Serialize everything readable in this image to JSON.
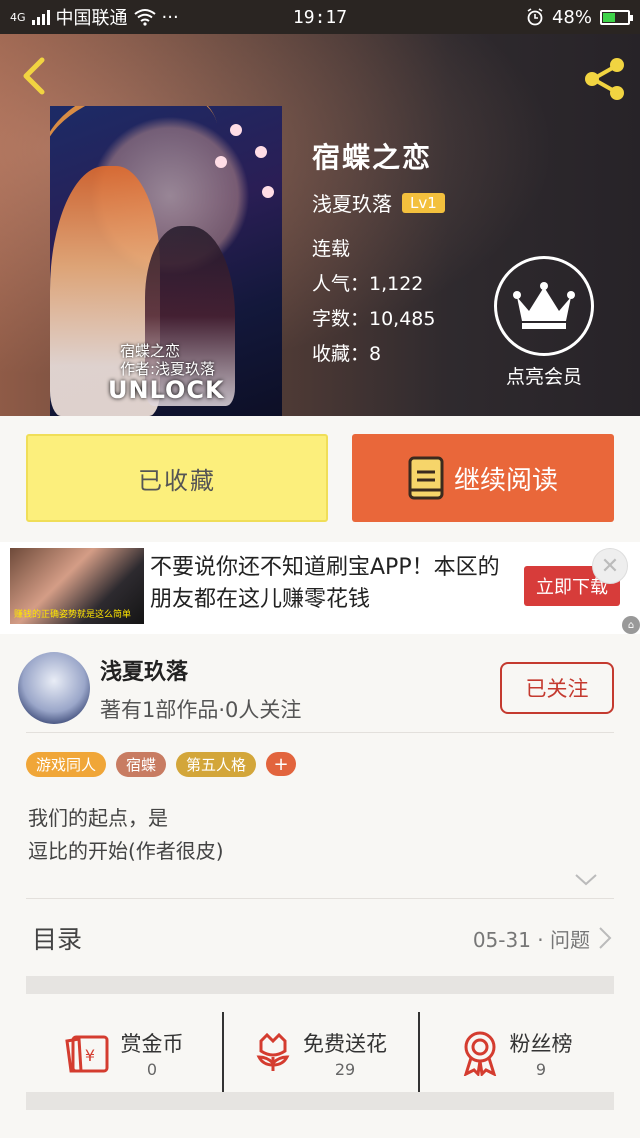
{
  "status_bar": {
    "network": "4G",
    "carrier": "中国联通",
    "more": "···",
    "time": "19:17",
    "battery": "48%",
    "battery_level": 0.48
  },
  "book": {
    "title": "宿蝶之恋",
    "author": "浅夏玖落",
    "level": "Lv1",
    "status": "连载",
    "popularity": "人气：1,122",
    "words": "字数：10,485",
    "favorites": "收藏：8",
    "cover_caption_line1": "宿蝶之恋",
    "cover_caption_line2": "作者:浅夏玖落",
    "cover_logo": "UNLOCK"
  },
  "vip": {
    "label": "点亮会员"
  },
  "actions": {
    "collected_label": "已收藏",
    "read_label": "继续阅读"
  },
  "ad": {
    "text": "不要说你还不知道刷宝APP！本区的朋友都在这儿赚零花钱",
    "cta": "立即下载",
    "thumb_caption": "赚钱的正确姿势就是这么简单"
  },
  "author": {
    "name": "浅夏玖落",
    "stats": "著有1部作品·0人关注",
    "follow_label": "已关注"
  },
  "tags": [
    {
      "label": "游戏同人",
      "color": "#f0a638"
    },
    {
      "label": "宿蝶",
      "color": "#c87c62"
    },
    {
      "label": "第五人格",
      "color": "#d3a63a"
    }
  ],
  "tag_more": "+",
  "intro": "我们的起点，是\n逗比的开始(作者很皮)",
  "catalog": {
    "title": "目录",
    "latest": "05-31 · 问题"
  },
  "stats": [
    {
      "label": "赏金币",
      "value": "0",
      "icon": "red-envelope-icon"
    },
    {
      "label": "免费送花",
      "value": "29",
      "icon": "flower-icon"
    },
    {
      "label": "粉丝榜",
      "value": "9",
      "icon": "medal-icon"
    }
  ],
  "colors": {
    "accent_orange": "#e9673a",
    "yellow_button": "#fcef7c",
    "follow_red": "#c43a2f",
    "ad_red": "#d73c3a"
  }
}
